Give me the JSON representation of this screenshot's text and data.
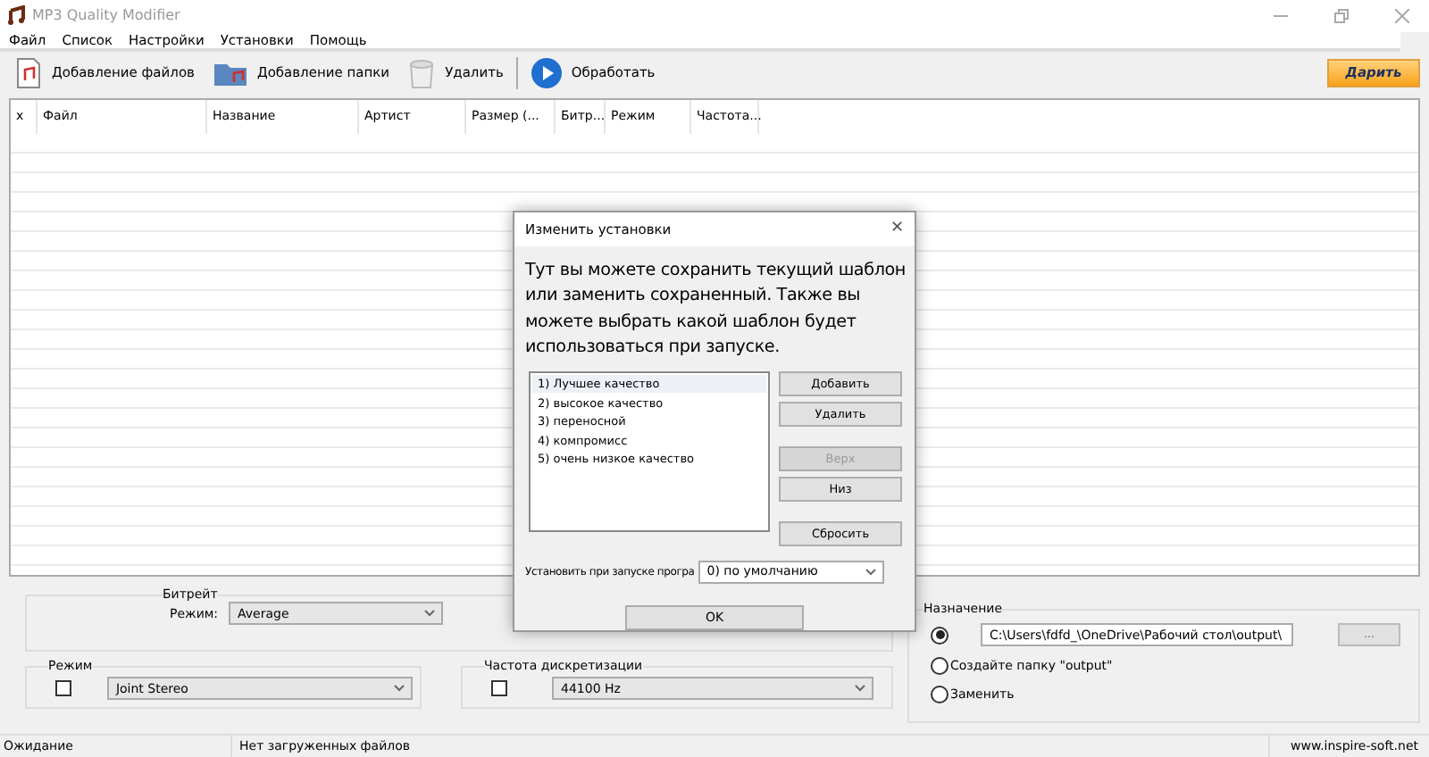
{
  "window": {
    "title": "MP3 Quality Modifier"
  },
  "menu": [
    "Файл",
    "Список",
    "Настройки",
    "Установки",
    "Помощь"
  ],
  "toolbar": [
    {
      "kind": "file",
      "label": "Добавление файлов"
    },
    {
      "kind": "folder",
      "label": "Добавление папки"
    },
    {
      "kind": "trash",
      "label": "Удалить"
    },
    {
      "kind": "play",
      "label": "Обработать"
    }
  ],
  "donate_button": "Дарить",
  "table": {
    "columns": [
      "x",
      "Файл",
      "Название",
      "Артист",
      "Размер (...",
      "Битр...",
      "Режим",
      "Частота..."
    ]
  },
  "bitrate": {
    "title": "Битрейт",
    "mode_label": "Режим:",
    "mode_value": "Average"
  },
  "mode": {
    "title": "Режим",
    "checked": false,
    "value": "Joint Stereo"
  },
  "sample_rate": {
    "title": "Частота дискретизации",
    "checked": false,
    "value": "44100 Hz"
  },
  "destination": {
    "title": "Назначение",
    "options": [
      {
        "kind": "path",
        "selected": true,
        "value": "C:\\Users\\fdfd_\\OneDrive\\Рабочий стол\\output\\",
        "browse": "..."
      },
      {
        "kind": "label",
        "selected": false,
        "label": "Создайте папку \"output\""
      },
      {
        "kind": "label",
        "selected": false,
        "label": "Заменить"
      }
    ]
  },
  "status_bar": {
    "state": "Ожидание",
    "message": "Нет загруженных файлов",
    "website": "www.inspire-soft.net"
  },
  "dialog": {
    "title": "Изменить установки",
    "close": "✕",
    "description": "Тут вы можете сохранить текущий шаблон или заменить сохраненный. Также вы можете выбрать какой шаблон будет использоваться при запуске.",
    "presets": [
      {
        "label": "1) Лучшее качество",
        "selected": true
      },
      {
        "label": "2) высокое качество",
        "selected": false
      },
      {
        "label": "3) переносной",
        "selected": false
      },
      {
        "label": "4) компромисс",
        "selected": false
      },
      {
        "label": "5) очень низкое качество",
        "selected": false
      }
    ],
    "button_groups": [
      [
        {
          "label": "Добавить",
          "disabled": false
        },
        {
          "label": "Удалить",
          "disabled": false
        }
      ],
      [
        {
          "label": "Верх",
          "disabled": true
        },
        {
          "label": "Низ",
          "disabled": false
        }
      ],
      [
        {
          "label": "Сбросить",
          "disabled": false
        }
      ]
    ],
    "startup_label": "Установить при запуске програ",
    "startup_value": "0) по умолчанию",
    "ok": "OK"
  }
}
